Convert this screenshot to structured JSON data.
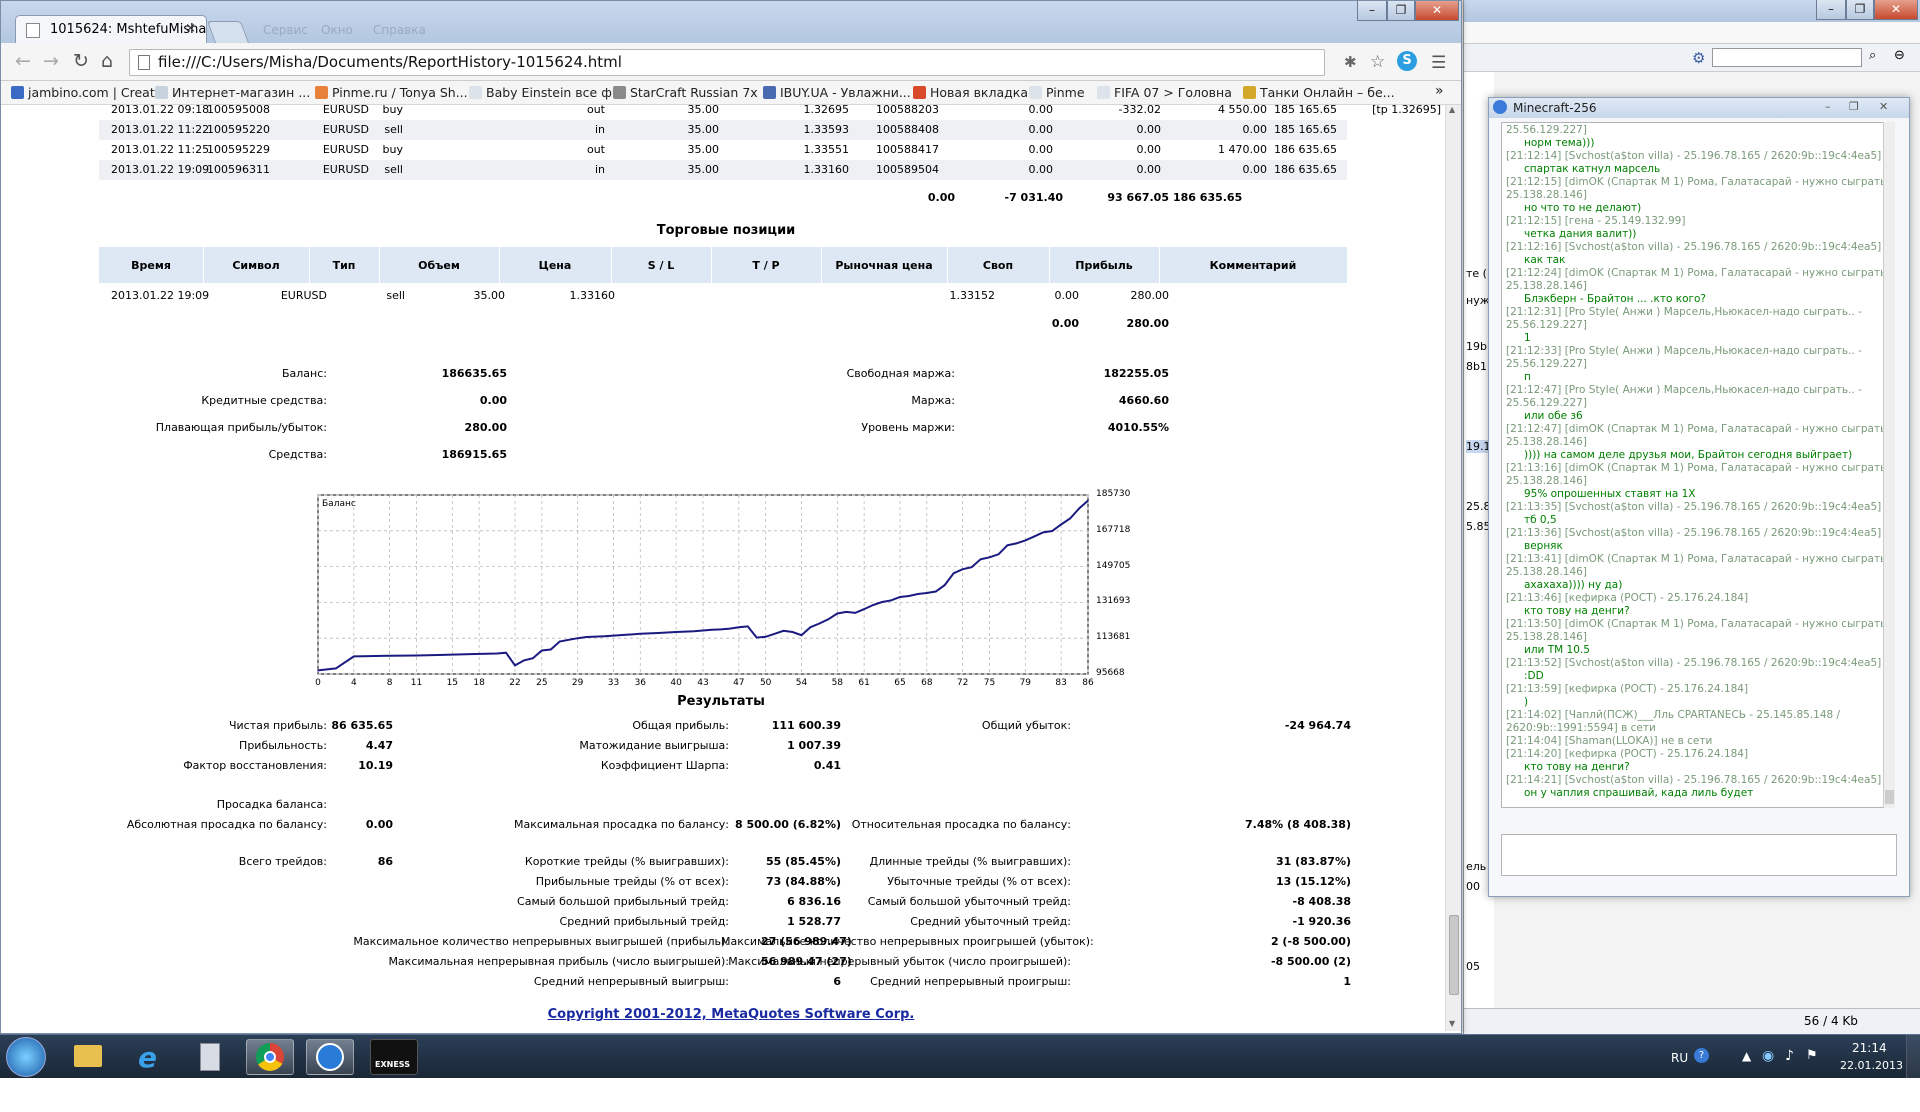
{
  "browser": {
    "tab_title": "1015624: MshtefuMisha - ",
    "tab_close": "×",
    "ghost_tabs": [
      "Сервис",
      "Окно",
      "Справка"
    ],
    "address": "file:///C:/Users/Misha/Documents/ReportHistory-1015624.html",
    "win_controls": [
      "–",
      "❐",
      "✕"
    ],
    "bookmarks": [
      {
        "label": "jambino.com | Creat...",
        "color": "#3a6bc4"
      },
      {
        "label": "Интернет-магазин ...",
        "color": "#c8d2dc"
      },
      {
        "label": "Pinme.ru / Tonya Sh...",
        "color": "#e8823a"
      },
      {
        "label": "Baby Einstein все ф...",
        "color": "#dde3ea"
      },
      {
        "label": "StarCraft Russian 7x ...",
        "color": "#8a8a8a"
      },
      {
        "label": "IBUY.UA - Увлажни...",
        "color": "#4a6ab0"
      },
      {
        "label": "Новая вкладка",
        "color": "#d84a2a"
      },
      {
        "label": "Pinme",
        "color": "#dde3ea"
      },
      {
        "label": "FIFA 07 > Головна",
        "color": "#dde3ea"
      },
      {
        "label": "Танки Онлайн – бе...",
        "color": "#d4a82a"
      }
    ],
    "bookmarks_more": "»"
  },
  "deals": [
    {
      "time": "2013.01.22 09:18",
      "deal": "100595008",
      "symbol": "EURUSD",
      "type": "buy",
      "dir": "out",
      "volume": "35.00",
      "price": "1.32695",
      "order": "100588203",
      "commission": "0.00",
      "swap": "-332.02",
      "profit": "4 550.00",
      "balance": "185 165.65",
      "comment": "[tp 1.32695]"
    },
    {
      "time": "2013.01.22 11:22",
      "deal": "100595220",
      "symbol": "EURUSD",
      "type": "sell",
      "dir": "in",
      "volume": "35.00",
      "price": "1.33593",
      "order": "100588408",
      "commission": "0.00",
      "swap": "0.00",
      "profit": "0.00",
      "balance": "185 165.65",
      "comment": ""
    },
    {
      "time": "2013.01.22 11:25",
      "deal": "100595229",
      "symbol": "EURUSD",
      "type": "buy",
      "dir": "out",
      "volume": "35.00",
      "price": "1.33551",
      "order": "100588417",
      "commission": "0.00",
      "swap": "0.00",
      "profit": "1 470.00",
      "balance": "186 635.65",
      "comment": ""
    },
    {
      "time": "2013.01.22 19:09",
      "deal": "100596311",
      "symbol": "EURUSD",
      "type": "sell",
      "dir": "in",
      "volume": "35.00",
      "price": "1.33160",
      "order": "100589504",
      "commission": "0.00",
      "swap": "0.00",
      "profit": "0.00",
      "balance": "186 635.65",
      "comment": ""
    }
  ],
  "deals_total": {
    "commission": "0.00",
    "swap": "-7 031.40",
    "profit": "93 667.05",
    "balance": "186 635.65"
  },
  "positions": {
    "title": "Торговые позиции",
    "headers": [
      "Время",
      "Символ",
      "Тип",
      "Объем",
      "Цена",
      "S / L",
      "T / P",
      "Рыночная цена",
      "Своп",
      "Прибыль",
      "Комментарий"
    ],
    "row": {
      "time": "2013.01.22 19:09",
      "symbol": "EURUSD",
      "type": "sell",
      "volume": "35.00",
      "price": "1.33160",
      "market": "1.33152",
      "swap": "0.00",
      "profit": "280.00"
    },
    "total": {
      "swap": "0.00",
      "profit": "280.00"
    }
  },
  "summary": {
    "balance_label": "Баланс:",
    "balance": "186635.65",
    "credit_label": "Кредитные средства:",
    "credit": "0.00",
    "floating_label": "Плавающая прибыль/убыток:",
    "floating": "280.00",
    "equity_label": "Средства:",
    "equity": "186915.65",
    "free_margin_label": "Свободная маржа:",
    "free_margin": "182255.05",
    "margin_label": "Маржа:",
    "margin": "4660.60",
    "margin_level_label": "Уровень маржи:",
    "margin_level": "4010.55%"
  },
  "chart_data": {
    "type": "line",
    "title": "Баланс",
    "x_ticks": [
      "0",
      "4",
      "8",
      "11",
      "15",
      "18",
      "22",
      "25",
      "29",
      "33",
      "36",
      "40",
      "43",
      "47",
      "50",
      "54",
      "58",
      "61",
      "65",
      "68",
      "72",
      "75",
      "79",
      "83",
      "86"
    ],
    "y_ticks": [
      "185730",
      "167718",
      "149705",
      "131693",
      "113681",
      "95668"
    ],
    "ylim": [
      95668,
      185730
    ],
    "xlim": [
      0,
      86
    ],
    "grid": true,
    "x": [
      0,
      2,
      4,
      5,
      8,
      11,
      14,
      17,
      20,
      21,
      22,
      23,
      24,
      25,
      26,
      27,
      28,
      29,
      30,
      32,
      34,
      36,
      38,
      40,
      42,
      44,
      45,
      46,
      47,
      48,
      49,
      50,
      51,
      52,
      53,
      54,
      55,
      56,
      57,
      58,
      59,
      60,
      61,
      62,
      63,
      64,
      65,
      66,
      67,
      68,
      69,
      70,
      71,
      72,
      73,
      74,
      75,
      76,
      77,
      78,
      79,
      80,
      81,
      82,
      83,
      84,
      85,
      86
    ],
    "y": [
      97500,
      98500,
      104500,
      104600,
      104800,
      105000,
      105300,
      105700,
      106000,
      106400,
      100000,
      102500,
      103600,
      107500,
      108000,
      112000,
      112900,
      113700,
      114300,
      114700,
      115300,
      115900,
      116300,
      116800,
      117200,
      117900,
      118100,
      118500,
      119200,
      119600,
      114000,
      114400,
      115900,
      117400,
      116800,
      115200,
      119200,
      121100,
      123200,
      126100,
      126900,
      126400,
      128300,
      130400,
      131900,
      132700,
      134400,
      134900,
      135900,
      136400,
      137200,
      140400,
      146400,
      148400,
      149400,
      153400,
      154400,
      155900,
      160400,
      161400,
      162900,
      164900,
      166900,
      167600,
      170900,
      173900,
      178900,
      182900
    ]
  },
  "results": {
    "title": "Результаты",
    "net_label": "Чистая прибыль:",
    "net": "86 635.65",
    "gross_profit_label": "Общая прибыль:",
    "gross_profit": "111 600.39",
    "gross_loss_label": "Общий убыток:",
    "gross_loss": "-24 964.74",
    "pf_label": "Прибыльность:",
    "pf": "4.47",
    "expect_label": "Матожидание выигрыша:",
    "expect": "1 007.39",
    "rf_label": "Фактор восстановления:",
    "rf": "10.19",
    "sharpe_label": "Коэффициент Шарпа:",
    "sharpe": "0.41",
    "dd_label": "Просадка баланса:",
    "abs_dd_label": "Абсолютная просадка по балансу:",
    "abs_dd": "0.00",
    "max_dd_label": "Максимальная просадка по балансу:",
    "max_dd": "8 500.00 (6.82%)",
    "rel_dd_label": "Относительная просадка по балансу:",
    "rel_dd": "7.48% (8 408.38)",
    "trades_label": "Всего трейдов:",
    "trades": "86",
    "short_label": "Короткие трейды (% выигравших):",
    "short": "55 (85.45%)",
    "long_label": "Длинные трейды (% выигравших):",
    "long": "31 (83.87%)",
    "prof_trades_label": "Прибыльные трейды (% от всех):",
    "prof_trades": "73 (84.88%)",
    "loss_trades_label": "Убыточные трейды (% от всех):",
    "loss_trades": "13 (15.12%)",
    "max_prof_label": "Самый большой прибыльный трейд:",
    "max_prof": "6 836.16",
    "max_loss_label": "Самый большой убыточный трейд:",
    "max_loss": "-8 408.38",
    "avg_prof_label": "Средний прибыльный трейд:",
    "avg_prof": "1 528.77",
    "avg_loss_label": "Средний убыточный трейд:",
    "avg_loss": "-1 920.36",
    "cons_wins_label": "Максимальное количество непрерывных выигрышей (прибыль):",
    "cons_wins": "27 (56 989.47)",
    "cons_losses_label": "Максимальное количество непрерывных проигрышей (убыток):",
    "cons_losses": "2 (-8 500.00)",
    "max_cons_prof_label": "Максимальная непрерывная прибыль (число выигрышей):",
    "max_cons_prof": "56 989.47 (27)",
    "max_cons_loss_label": "Максимальный непрерывный убыток (число проигрышей):",
    "max_cons_loss": "-8 500.00 (2)",
    "avg_cons_wins_label": "Средний непрерывный выигрыш:",
    "avg_cons_wins": "6",
    "avg_cons_losses_label": "Средний непрерывный проигрыш:",
    "avg_cons_losses": "1"
  },
  "copyright": "Copyright 2001-2012, MetaQuotes Software Corp.",
  "minecraft": {
    "title": "Minecraft-256",
    "lines": [
      {
        "k": "meta",
        "t": "25.56.129.227]"
      },
      {
        "k": "msg",
        "t": "норм тема)))"
      },
      {
        "k": "meta",
        "t": "[21:12:14]      [Svchost(a$ton villa) - 25.196.78.165 / 2620:9b::19c4:4ea5]"
      },
      {
        "k": "msg",
        "t": "спартак катнул марсель"
      },
      {
        "k": "meta",
        "t": "[21:12:15]      [dimOK (Спартак М 1) Рома, Галатасарай - нужно сыграть -"
      },
      {
        "k": "meta",
        "t": "25.138.28.146]"
      },
      {
        "k": "msg",
        "t": "но что то не делают)"
      },
      {
        "k": "meta",
        "t": "[21:12:15]      [гена - 25.149.132.99]"
      },
      {
        "k": "msg",
        "t": "четка дания валит))"
      },
      {
        "k": "meta",
        "t": "[21:12:16]      [Svchost(a$ton villa) - 25.196.78.165 / 2620:9b::19c4:4ea5]"
      },
      {
        "k": "msg",
        "t": "как так"
      },
      {
        "k": "meta",
        "t": "[21:12:24]      [dimOK (Спартак М 1) Рома, Галатасарай - нужно сыграть -"
      },
      {
        "k": "meta",
        "t": "25.138.28.146]"
      },
      {
        "k": "msg",
        "t": "Блэкберн - Брайтон ... .кто кого?"
      },
      {
        "k": "meta",
        "t": "[21:12:31]      [Pro Style( Анжи ) Марсель,Ньюкасел-надо сыграть.. -"
      },
      {
        "k": "meta",
        "t": "25.56.129.227]"
      },
      {
        "k": "msg",
        "t": "1"
      },
      {
        "k": "meta",
        "t": "[21:12:33]      [Pro Style( Анжи ) Марсель,Ньюкасел-надо сыграть.. -"
      },
      {
        "k": "meta",
        "t": "25.56.129.227]"
      },
      {
        "k": "msg",
        "t": "п"
      },
      {
        "k": "meta",
        "t": "[21:12:47]      [Pro Style( Анжи ) Марсель,Ньюкасел-надо сыграть.. -"
      },
      {
        "k": "meta",
        "t": "25.56.129.227]"
      },
      {
        "k": "msg",
        "t": "или обе з6"
      },
      {
        "k": "meta",
        "t": "[21:12:47]      [dimOK (Спартак М 1) Рома, Галатасарай - нужно сыграть -"
      },
      {
        "k": "meta",
        "t": "25.138.28.146]"
      },
      {
        "k": "msg",
        "t": ")))) на самом деле друзья мои, Брайтон сегодня выйграет)"
      },
      {
        "k": "meta",
        "t": "[21:13:16]      [dimOK (Спартак М 1) Рома, Галатасарай - нужно сыграть -"
      },
      {
        "k": "meta",
        "t": "25.138.28.146]"
      },
      {
        "k": "msg",
        "t": "95% опрошенных ставят на 1Х"
      },
      {
        "k": "meta",
        "t": "[21:13:35]      [Svchost(a$ton villa) - 25.196.78.165 / 2620:9b::19c4:4ea5]"
      },
      {
        "k": "msg",
        "t": "тб 0,5"
      },
      {
        "k": "meta",
        "t": "[21:13:36]      [Svchost(a$ton villa) - 25.196.78.165 / 2620:9b::19c4:4ea5]"
      },
      {
        "k": "msg",
        "t": "верняк"
      },
      {
        "k": "meta",
        "t": "[21:13:41]      [dimOK (Спартак М 1) Рома, Галатасарай - нужно сыграть -"
      },
      {
        "k": "meta",
        "t": "25.138.28.146]"
      },
      {
        "k": "msg",
        "t": "ахахаха)))) ну да)"
      },
      {
        "k": "meta",
        "t": "[21:13:46]      [кефирка (РОСТ) - 25.176.24.184]"
      },
      {
        "k": "msg",
        "t": "кто тову на денги?"
      },
      {
        "k": "meta",
        "t": "[21:13:50]      [dimOK (Спартак М 1) Рома, Галатасарай - нужно сыграть -"
      },
      {
        "k": "meta",
        "t": "25.138.28.146]"
      },
      {
        "k": "msg",
        "t": "или ТМ 10.5"
      },
      {
        "k": "meta",
        "t": "[21:13:52]      [Svchost(a$ton villa) - 25.196.78.165 / 2620:9b::19c4:4ea5]"
      },
      {
        "k": "msg",
        "t": ":DD"
      },
      {
        "k": "meta",
        "t": "[21:13:59]      [кефирка (РОСТ) - 25.176.24.184]"
      },
      {
        "k": "msg",
        "t": ")"
      },
      {
        "k": "meta",
        "t": "[21:14:02]      [Чаплй(ПСЖ)___Лль СPARTANECЬ - 25.145.85.148 /"
      },
      {
        "k": "meta",
        "t": "2620:9b::1991:5594] в сети"
      },
      {
        "k": "meta",
        "t": "[21:14:04]      [Shaman(LLOKA)] не в сети"
      },
      {
        "k": "meta",
        "t": "[21:14:20]      [кефирка (РОСТ) - 25.176.24.184]"
      },
      {
        "k": "msg",
        "t": "кто тову на денги?"
      },
      {
        "k": "meta",
        "t": "[21:14:21]      [Svchost(a$ton villa) - 25.196.78.165 / 2620:9b::19c4:4ea5]"
      },
      {
        "k": "msg",
        "t": "он у чаплия спрашивай, када лиль будет"
      }
    ]
  },
  "background": {
    "frag": [
      "те (",
      "19b1",
      "8b1:",
      "19.1",
      "25.8",
      "5.85",
      "нуж",
      "ель",
      "00",
      "05"
    ],
    "status": "56 / 4 Kb"
  },
  "tray": {
    "lang": "RU",
    "time": "21:14",
    "date": "22.01.2013"
  },
  "taskbar": {
    "exness": "EXNESS"
  }
}
